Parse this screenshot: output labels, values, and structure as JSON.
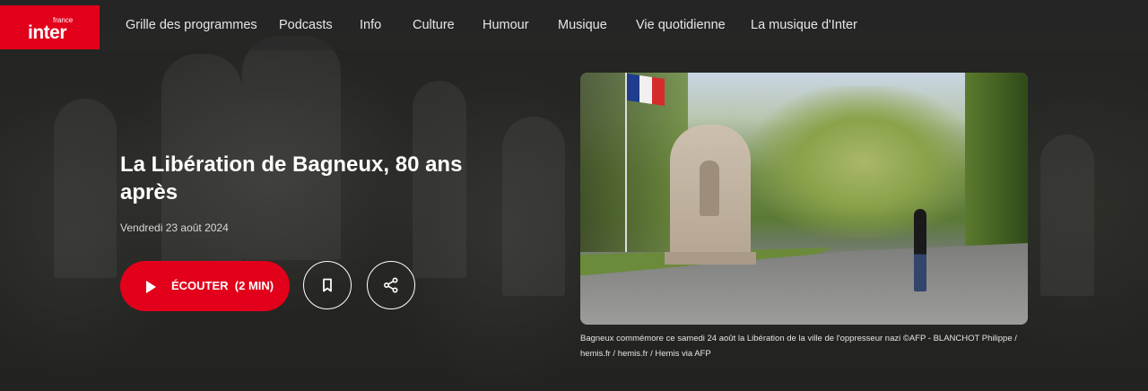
{
  "logo": {
    "small": "france",
    "big": "inter"
  },
  "nav": {
    "items": [
      "Grille des programmes",
      "Podcasts",
      "Info",
      "Culture",
      "Humour",
      "Musique",
      "Vie quotidienne",
      "La musique d'Inter"
    ]
  },
  "article": {
    "title": "La Libération de Bagneux, 80 ans après",
    "date": "Vendredi 23 août 2024",
    "listen_label": "ÉCOUTER",
    "listen_duration": "(2 MIN)"
  },
  "image": {
    "caption": "Bagneux commémore ce samedi 24 août la Libération de la ville de l'oppresseur nazi ©AFP - BLANCHOT Philippe / hemis.fr / hemis.fr / Hemis via AFP"
  },
  "icons": {
    "play": "play-icon",
    "bookmark": "bookmark-icon",
    "share": "share-icon"
  },
  "colors": {
    "brand_red": "#e2001a",
    "text": "#ffffff"
  }
}
